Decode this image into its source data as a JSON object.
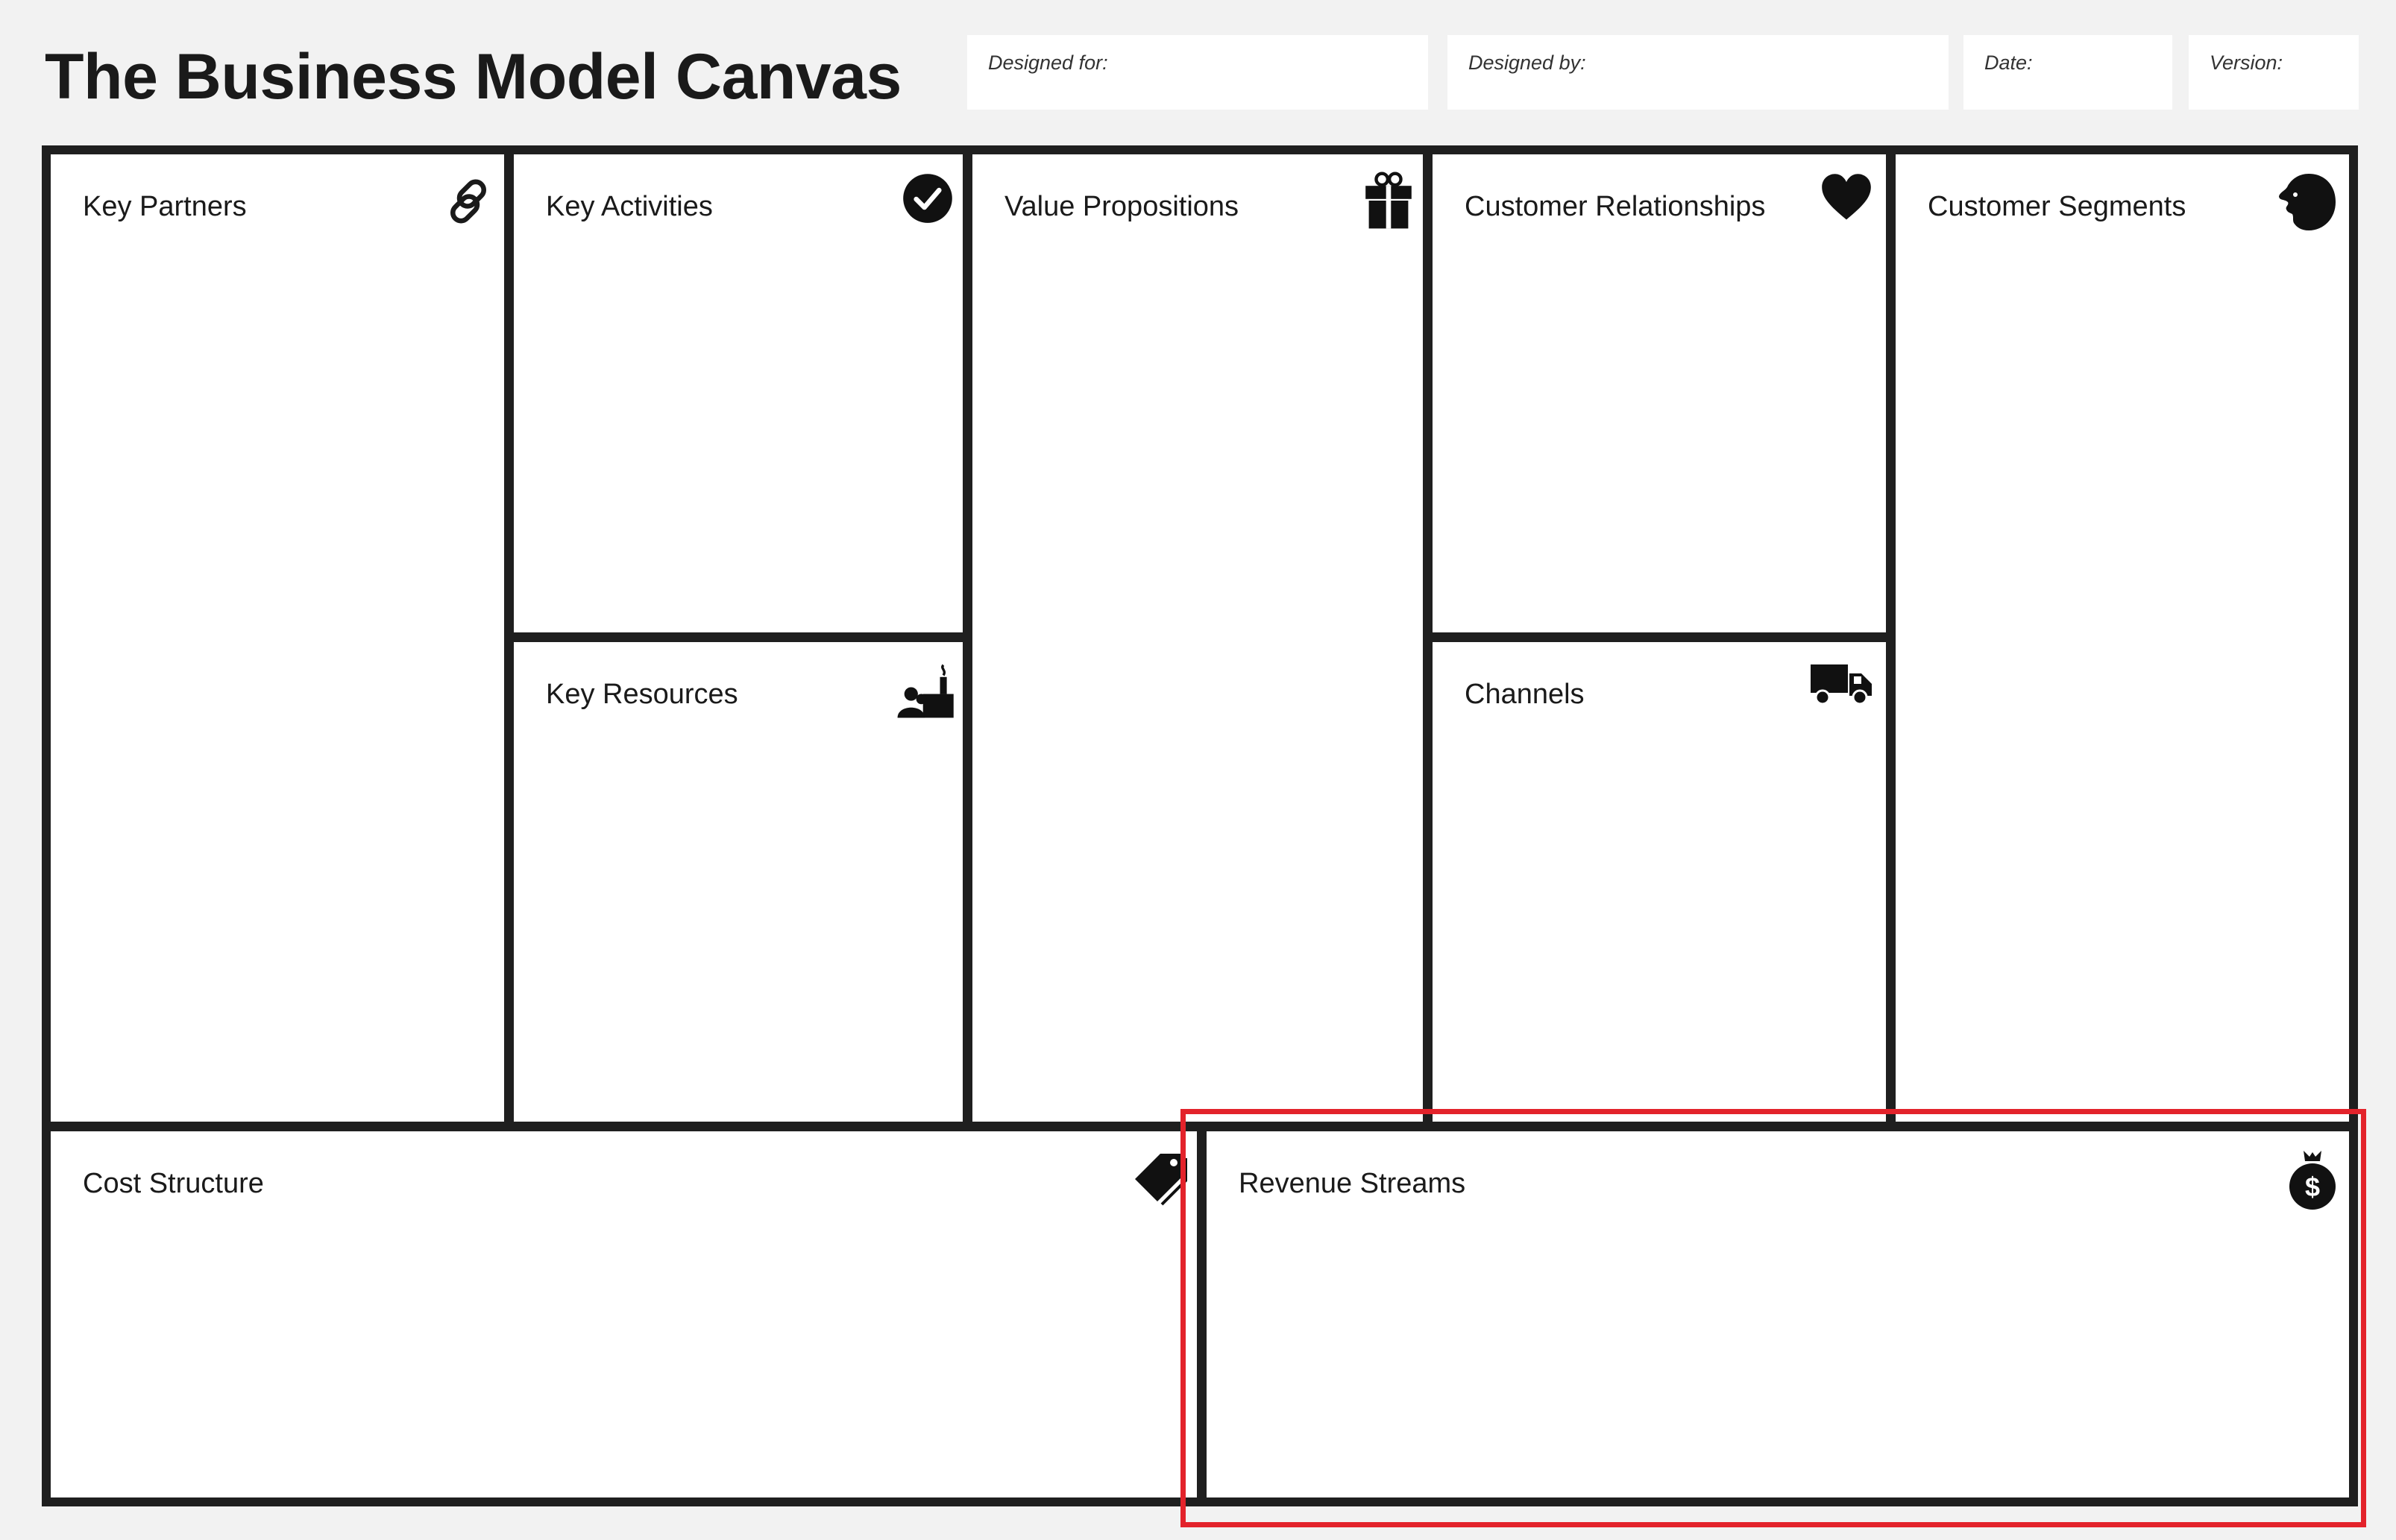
{
  "page": {
    "title": "The Business Model Canvas"
  },
  "header": {
    "designed_for_label": "Designed for:",
    "designed_by_label": "Designed by:",
    "date_label": "Date:",
    "version_label": "Version:"
  },
  "blocks": {
    "key_partners": {
      "title": "Key Partners",
      "icon": "link-icon"
    },
    "key_activities": {
      "title": "Key Activities",
      "icon": "checkmark-circle-icon"
    },
    "key_resources": {
      "title": "Key Resources",
      "icon": "factory-worker-icon"
    },
    "value_propositions": {
      "title": "Value Propositions",
      "icon": "gift-icon"
    },
    "customer_relationships": {
      "title": "Customer Relationships",
      "icon": "heart-icon"
    },
    "channels": {
      "title": "Channels",
      "icon": "delivery-truck-icon"
    },
    "customer_segments": {
      "title": "Customer Segments",
      "icon": "person-head-icon"
    },
    "cost_structure": {
      "title": "Cost Structure",
      "icon": "price-tag-icon"
    },
    "revenue_streams": {
      "title": "Revenue Streams",
      "icon": "money-bag-icon"
    }
  },
  "colors": {
    "background": "#f2f2f2",
    "frame": "#1f1f1f",
    "block": "#ffffff",
    "highlight": "#e3232b"
  }
}
